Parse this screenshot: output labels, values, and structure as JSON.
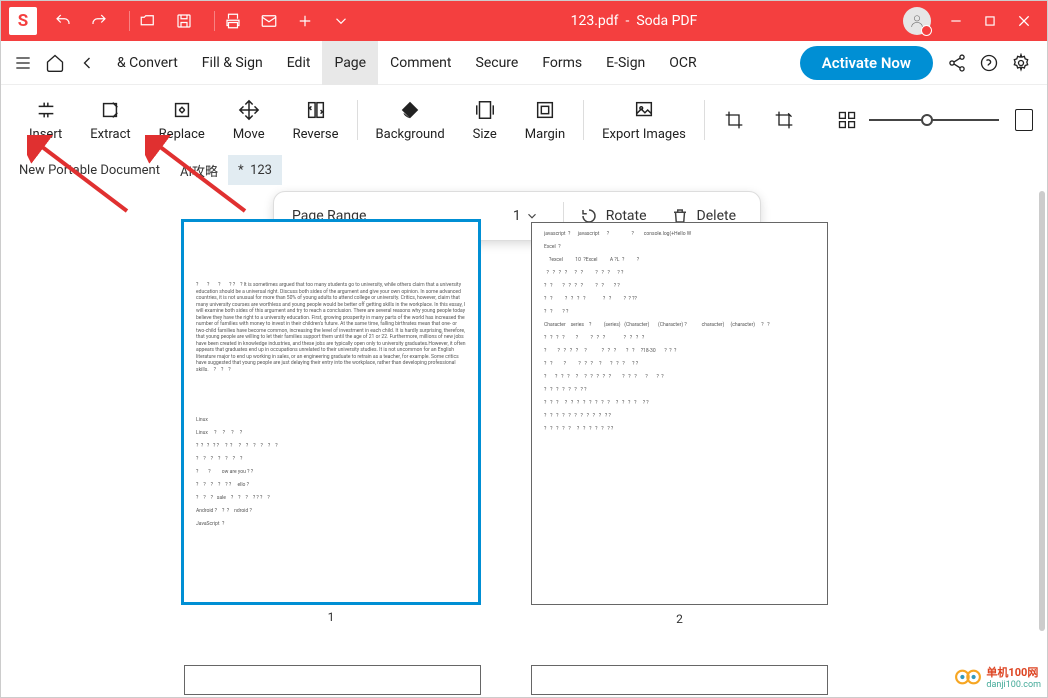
{
  "title": {
    "filename": "123.pdf",
    "appname": "Soda PDF"
  },
  "menubar": {
    "convert": "& Convert",
    "fillsign": "Fill & Sign",
    "edit": "Edit",
    "page": "Page",
    "comment": "Comment",
    "secure": "Secure",
    "forms": "Forms",
    "esign": "E-Sign",
    "ocr": "OCR",
    "activate": "Activate Now"
  },
  "ribbon": {
    "insert": "Insert",
    "extract": "Extract",
    "replace": "Replace",
    "move": "Move",
    "reverse": "Reverse",
    "background": "Background",
    "size": "Size",
    "margin": "Margin",
    "export": "Export Images"
  },
  "tabs": {
    "t1": "New Portable Document",
    "t2": "AI攻略",
    "t3_modified": "*",
    "t3": "123"
  },
  "floatbar": {
    "pageRange": "Page Range",
    "pageValue": "1",
    "rotate": "Rotate",
    "delete": "Delete"
  },
  "pages": {
    "p1": "1",
    "p2": "2"
  },
  "watermark": {
    "line1": "单机100网",
    "line2": "danji100.com"
  }
}
